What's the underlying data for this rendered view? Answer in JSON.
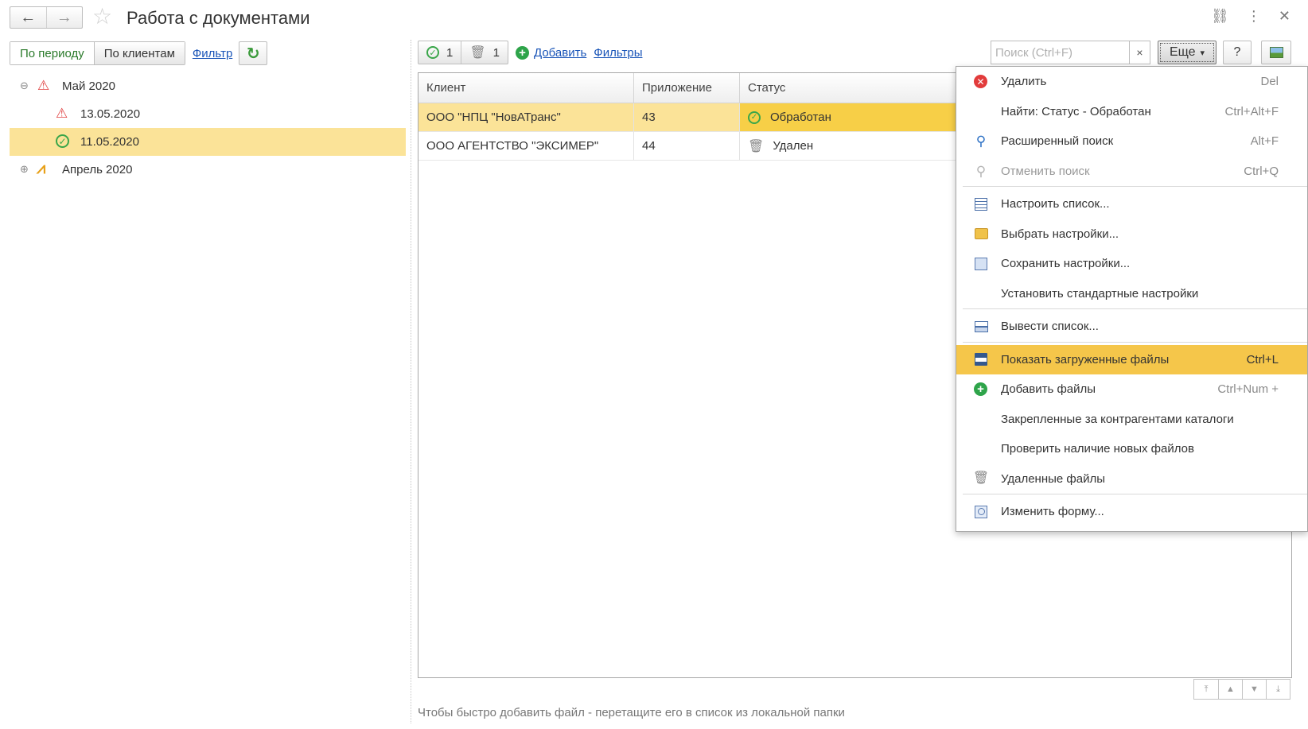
{
  "window": {
    "title": "Работа с документами"
  },
  "left_panel": {
    "segment_by_period": "По периоду",
    "segment_by_clients": "По клиентам",
    "filter_link": "Фильтр",
    "tree": [
      {
        "label": "Май 2020",
        "icon": "warning-triangle-icon",
        "expander": "⊖",
        "level": 0
      },
      {
        "label": "13.05.2020",
        "icon": "warning-triangle-icon",
        "level": 1
      },
      {
        "label": "11.05.2020",
        "icon": "check-circle-icon",
        "level": 1,
        "selected": true
      },
      {
        "label": "Апрель 2020",
        "icon": "mixed-status-icon",
        "expander": "⊕",
        "level": 0
      }
    ]
  },
  "toolbar": {
    "processed_count": "1",
    "deleted_count": "1",
    "add_link": "Добавить",
    "filters_link": "Фильтры",
    "search_placeholder": "Поиск (Ctrl+F)",
    "search_clear": "×",
    "more_button": "Еще",
    "more_arrow": "▾",
    "help_button": "?"
  },
  "table": {
    "columns": [
      "Клиент",
      "Приложение",
      "Статус"
    ],
    "rows": [
      {
        "client": "ООО \"НПЦ \"НовАТранс\"",
        "app": "43",
        "status": "Обработан",
        "status_icon": "check-circle-icon"
      },
      {
        "client": "ООО АГЕНТСТВО \"ЭКСИМЕР\"",
        "app": "44",
        "status": "Удален",
        "status_icon": "trash-icon"
      }
    ]
  },
  "hint": "Чтобы быстро добавить файл - перетащите его в список из локальной папки",
  "menu": {
    "items": [
      {
        "label": "Удалить",
        "shortcut": "Del",
        "icon": "delete-red-icon"
      },
      {
        "label": "Найти: Статус - Обработан",
        "shortcut": "Ctrl+Alt+F",
        "icon": ""
      },
      {
        "label": "Расширенный поиск",
        "shortcut": "Alt+F",
        "icon": "search-icon"
      },
      {
        "label": "Отменить поиск",
        "shortcut": "Ctrl+Q",
        "icon": "search-cancel-icon",
        "disabled": true
      },
      {
        "label": "Настроить список...",
        "shortcut": "",
        "icon": "list-settings-icon"
      },
      {
        "label": "Выбрать настройки...",
        "shortcut": "",
        "icon": "folder-settings-icon"
      },
      {
        "label": "Сохранить настройки...",
        "shortcut": "",
        "icon": "save-settings-icon"
      },
      {
        "label": "Установить стандартные настройки",
        "shortcut": "",
        "icon": ""
      },
      {
        "label": "Вывести список...",
        "shortcut": "",
        "icon": "print-icon"
      },
      {
        "label": "Показать загруженные файлы",
        "shortcut": "Ctrl+L",
        "icon": "floppy-icon",
        "highlighted": true
      },
      {
        "label": "Добавить файлы",
        "shortcut": "Ctrl+Num +",
        "icon": "add-green-icon"
      },
      {
        "label": "Закрепленные за контрагентами каталоги",
        "shortcut": "",
        "icon": ""
      },
      {
        "label": "Проверить наличие новых файлов",
        "shortcut": "",
        "icon": ""
      },
      {
        "label": "Удаленные файлы",
        "shortcut": "",
        "icon": "trash-icon"
      },
      {
        "label": "Изменить форму...",
        "shortcut": "",
        "icon": "form-icon"
      }
    ]
  },
  "colors": {
    "selection": "#fbe398",
    "menu_highlight": "#f5c64a",
    "link": "#1a55b8",
    "ok_green": "#3aa64a",
    "error_red": "#e23b3b"
  }
}
